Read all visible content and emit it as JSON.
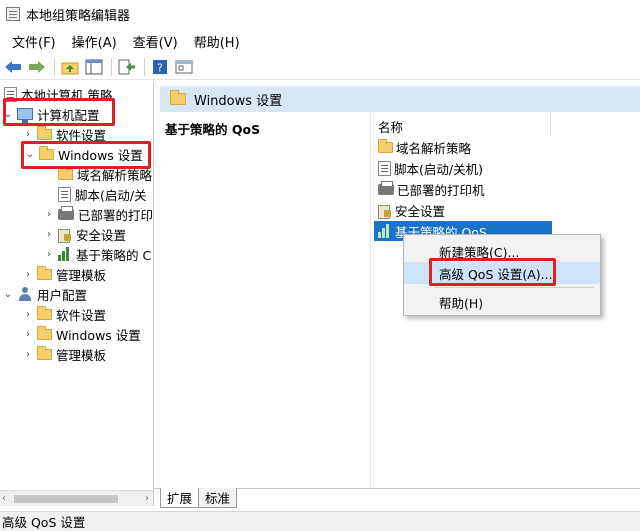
{
  "window": {
    "title": "本地组策略编辑器"
  },
  "menu": [
    "文件(F)",
    "操作(A)",
    "查看(V)",
    "帮助(H)"
  ],
  "toolbar": {
    "icons": [
      "back-arrow-icon",
      "forward-arrow-icon",
      "up-folder-icon",
      "show-tree-icon",
      "export-list-icon",
      "help-icon",
      "properties-icon"
    ]
  },
  "tree": {
    "root": "本地计算机 策略",
    "computer_config": "计算机配置",
    "software_settings_partial": "软件设置",
    "windows_settings": "Windows 设置",
    "dns_policy": "域名解析策略",
    "scripts": "脚本(启动/关",
    "printers": "已部署的打印",
    "security": "安全设置",
    "qos": "基于策略的 C",
    "admin_templates": "管理模板",
    "user_config": "用户配置",
    "user_software": "软件设置",
    "user_windows": "Windows 设置",
    "user_admin_templates": "管理模板"
  },
  "right": {
    "header": "Windows 设置",
    "description_title": "基于策略的 QoS",
    "column_name": "名称",
    "items": [
      "域名解析策略",
      "脚本(启动/关机)",
      "已部署的打印机",
      "安全设置",
      "基于策略的 QoS"
    ]
  },
  "context_menu": {
    "new_policy": "新建策略(C)...",
    "advanced_qos": "高级 QoS 设置(A)...",
    "help": "帮助(H)"
  },
  "tabs": [
    "扩展",
    "标准"
  ],
  "status": "高级 QoS 设置",
  "colors": {
    "selection": "#1a73c9",
    "header_bg": "#d9e6f4",
    "highlight_box": "#e02020",
    "menu_hover": "#cde3f7"
  }
}
